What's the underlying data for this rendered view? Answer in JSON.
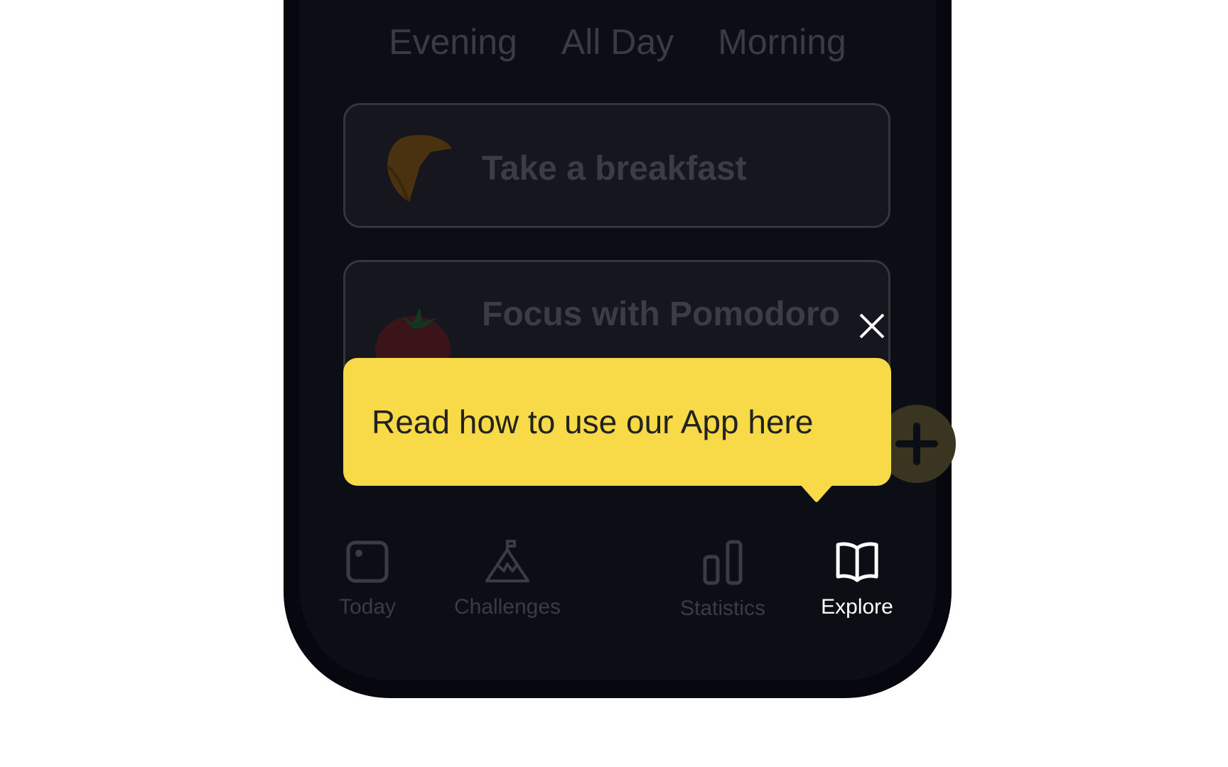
{
  "filter_tabs": [
    "Evening",
    "All Day",
    "Morning"
  ],
  "habits": [
    {
      "title": "Take a breakfast",
      "icon": "croissant-icon"
    },
    {
      "title": "Focus with Pomodoro",
      "icon": "tomato-icon"
    }
  ],
  "tooltip": {
    "text": "Read how to use our App here",
    "color": "#f8d947"
  },
  "nav": [
    {
      "label": "Today",
      "icon": "calendar-icon"
    },
    {
      "label": "Challenges",
      "icon": "mountain-flag-icon"
    },
    {
      "label": "Statistics",
      "icon": "bar-chart-icon"
    },
    {
      "label": "Explore",
      "icon": "book-icon",
      "active": true
    }
  ],
  "add_button": {
    "icon": "plus-icon"
  }
}
